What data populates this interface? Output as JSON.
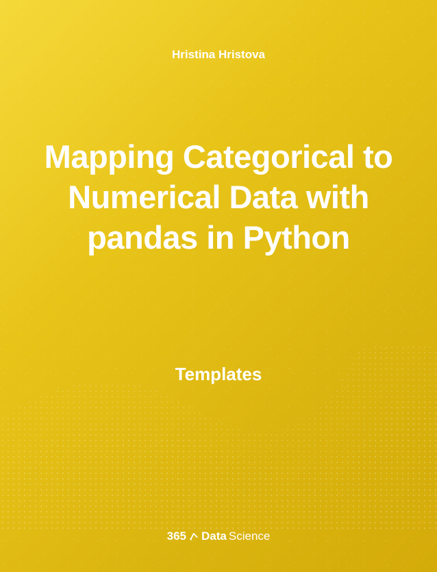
{
  "author": "Hristina Hristova",
  "title": "Mapping Categorical to Numerical Data with pandas in Python",
  "subtitle": "Templates",
  "brand": {
    "prefix": "365",
    "word1": "Data",
    "word2": "Science"
  }
}
